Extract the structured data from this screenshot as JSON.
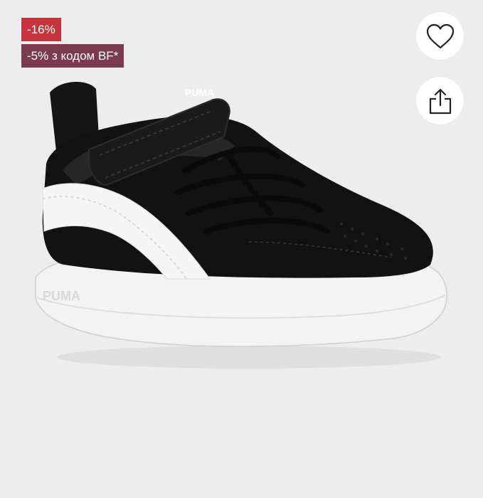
{
  "badges": {
    "discount": "-16%",
    "promo": "-5% з кодом BF*"
  },
  "actions": {
    "favorite_icon": "heart-icon",
    "share_icon": "share-icon"
  },
  "product": {
    "brand_logo_text": "PUMA",
    "image_subject": "sneaker"
  },
  "colors": {
    "discount_badge": "#c8343c",
    "promo_badge": "#7b3b4f",
    "background": "#ededed"
  }
}
